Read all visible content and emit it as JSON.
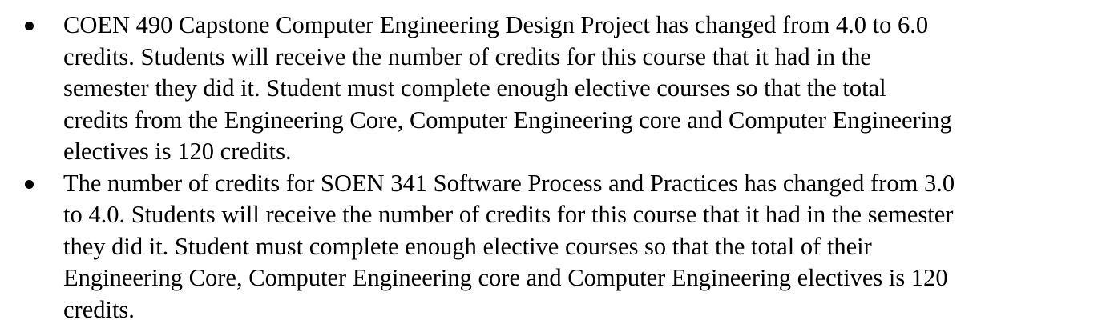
{
  "document": {
    "bullets": [
      {
        "lines": [
          "COEN 490 Capstone Computer Engineering Design Project has changed from 4.0 to 6.0",
          "credits. Students will receive the number of credits for this course that it had in the",
          "semester they did it. Student must complete enough elective courses so that the total",
          "credits from the Engineering Core, Computer Engineering core and Computer Engineering",
          "electives is 120 credits."
        ]
      },
      {
        "lines": [
          "The number of credits for SOEN 341 Software Process and Practices has changed from 3.0",
          "to 4.0. Students will receive the number of credits for this course that it had in the semester",
          "they did it. Student must complete enough elective courses so that the total of their",
          "Engineering Core, Computer Engineering core and Computer Engineering electives is 120",
          "credits."
        ]
      }
    ]
  }
}
